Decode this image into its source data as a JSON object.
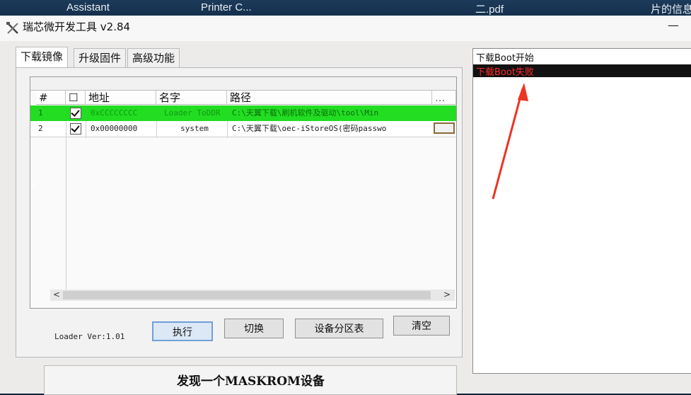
{
  "desktop": {
    "labels": [
      "Assistant",
      "Printer C...",
      "二.pdf",
      "片的信息"
    ]
  },
  "window": {
    "title": "瑞芯微开发工具 v2.84",
    "minimize": "—"
  },
  "tabs": [
    "下载镜像",
    "升级固件",
    "高级功能"
  ],
  "table": {
    "headers": [
      "#",
      "☐",
      "地址",
      "名字",
      "路径",
      "..."
    ],
    "rows": [
      {
        "num": "1",
        "checked": true,
        "address": "0xCCCCCCCC",
        "name": "Loader ToDDR",
        "path": "C:\\天翼下载\\刷机软件及驱动\\tool\\Min"
      },
      {
        "num": "2",
        "checked": true,
        "address": "0x00000000",
        "name": "system",
        "path": "C:\\天翼下载\\oec-iStoreOS(密码passwo"
      }
    ],
    "colors": {
      "highlight": "#22dd22"
    }
  },
  "loader_ver": "Loader Ver:1.01",
  "buttons": {
    "run": "执行",
    "switch": "切换",
    "partition": "设备分区表",
    "clear": "清空"
  },
  "status": "发现一个MASKROM设备",
  "log": {
    "lines": [
      "下载Boot开始",
      "下载Boot失败"
    ],
    "error_color": "#ff2a2a"
  },
  "nav": {
    "prev": "‹",
    "next": "›"
  }
}
